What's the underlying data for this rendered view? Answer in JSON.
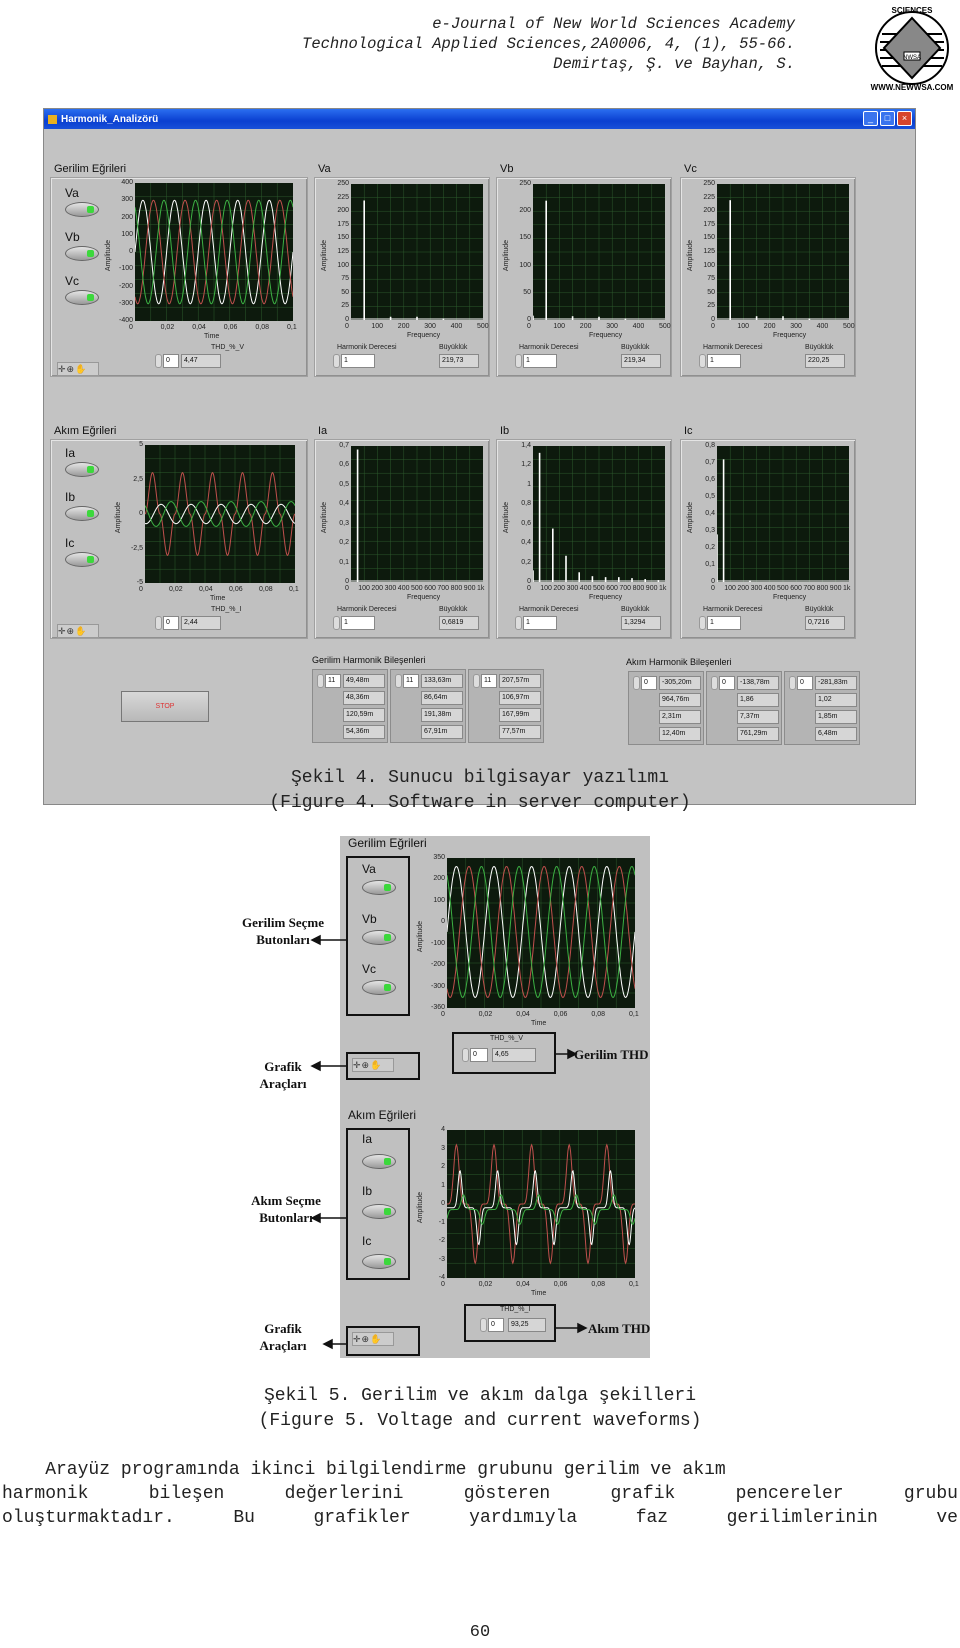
{
  "header": {
    "line1": "e-Journal of New World Sciences Academy",
    "line2": "Technological Applied Sciences,2A0006, 4, (1), 55-66.",
    "line3": "Demirtaş, Ş. ve Bayhan, S.",
    "logo_text_top": "SCIENCES",
    "logo_text_left": "NEW WORLD",
    "logo_text_right": "ACADEMY",
    "logo_url": "WWW.NEWWSA.COM",
    "logo_center": "NWSA"
  },
  "window": {
    "title": "Harmonik_Analizörü",
    "buttons": [
      "_",
      "□",
      "×"
    ]
  },
  "voltage": {
    "group_title": "Gerilim Eğrileri",
    "switches": [
      "Va",
      "Vb",
      "Vc"
    ],
    "yticks": [
      "400",
      "300",
      "200",
      "100",
      "0",
      "-100",
      "-200",
      "-300",
      "-400"
    ],
    "xticks": [
      "0",
      "0,02",
      "0,04",
      "0,06",
      "0,08",
      "0,1"
    ],
    "xlabel": "Time",
    "ylabel": "Amplitude",
    "thd_label": "THD_%_V",
    "thd_index": "0",
    "thd_value": "4,47"
  },
  "current": {
    "group_title": "Akım Eğrileri",
    "switches": [
      "Ia",
      "Ib",
      "Ic"
    ],
    "yticks": [
      "5",
      "2,5",
      "0",
      "-2,5",
      "-5"
    ],
    "xticks": [
      "0",
      "0,02",
      "0,04",
      "0,06",
      "0,08",
      "0,1"
    ],
    "xlabel": "Time",
    "ylabel": "Amplitude",
    "thd_label": "THD_%_I",
    "thd_index": "0",
    "thd_value": "2,44"
  },
  "spectra": [
    {
      "title": "Va",
      "yticks": [
        "250",
        "225",
        "200",
        "175",
        "150",
        "125",
        "100",
        "75",
        "50",
        "25",
        "0"
      ],
      "xticks": [
        "0",
        "100",
        "200",
        "300",
        "400",
        "500"
      ],
      "xlabel": "Frequency",
      "ylabel": "Amplitude",
      "harm_label": "Harmonik Derecesi",
      "harm_value": "1",
      "mag_label": "Büyüklük",
      "mag_value": "219,73"
    },
    {
      "title": "Vb",
      "yticks": [
        "250",
        "200",
        "150",
        "100",
        "50",
        "0"
      ],
      "xticks": [
        "0",
        "100",
        "200",
        "300",
        "400",
        "500"
      ],
      "xlabel": "Frequency",
      "ylabel": "Amplitude",
      "harm_label": "Harmonik Derecesi",
      "harm_value": "1",
      "mag_label": "Büyüklük",
      "mag_value": "219,34"
    },
    {
      "title": "Vc",
      "yticks": [
        "250",
        "225",
        "200",
        "175",
        "150",
        "125",
        "100",
        "75",
        "50",
        "25",
        "0"
      ],
      "xticks": [
        "0",
        "100",
        "200",
        "300",
        "400",
        "500"
      ],
      "xlabel": "Frequency",
      "ylabel": "Amplitude",
      "harm_label": "Harmonik Derecesi",
      "harm_value": "1",
      "mag_label": "Büyüklük",
      "mag_value": "220,25"
    },
    {
      "title": "Ia",
      "yticks": [
        "0,7",
        "0,6",
        "0,5",
        "0,4",
        "0,3",
        "0,2",
        "0,1",
        "0"
      ],
      "xticks": [
        "0",
        "100",
        "200",
        "300",
        "400",
        "500",
        "600",
        "700",
        "800",
        "900",
        "1k"
      ],
      "xlabel": "Frequency",
      "ylabel": "Amplitude",
      "harm_label": "Harmonik Derecesi",
      "harm_value": "1",
      "mag_label": "Büyüklük",
      "mag_value": "0,6819"
    },
    {
      "title": "Ib",
      "yticks": [
        "1,4",
        "1,2",
        "1",
        "0,8",
        "0,6",
        "0,4",
        "0,2",
        "0"
      ],
      "xticks": [
        "0",
        "100",
        "200",
        "300",
        "400",
        "500",
        "600",
        "700",
        "800",
        "900",
        "1k"
      ],
      "xlabel": "Frequency",
      "ylabel": "Amplitude",
      "harm_label": "Harmonik Derecesi",
      "harm_value": "1",
      "mag_label": "Büyüklük",
      "mag_value": "1,3294"
    },
    {
      "title": "Ic",
      "yticks": [
        "0,8",
        "0,7",
        "0,6",
        "0,5",
        "0,4",
        "0,3",
        "0,2",
        "0,1",
        "0"
      ],
      "xticks": [
        "0",
        "100",
        "200",
        "300",
        "400",
        "500",
        "600",
        "700",
        "800",
        "900",
        "1k"
      ],
      "xlabel": "Frequency",
      "ylabel": "Amplitude",
      "harm_label": "Harmonik Derecesi",
      "harm_value": "1",
      "mag_label": "Büyüklük",
      "mag_value": "0,7216"
    }
  ],
  "stop_label": "STOP",
  "voltage_harmonics": {
    "title": "Gerilim Harmonik Bileşenleri",
    "arrays": [
      {
        "index": "11",
        "values": [
          "49,48m",
          "48,36m",
          "120,59m",
          "54,36m"
        ]
      },
      {
        "index": "11",
        "values": [
          "133,63m",
          "86,64m",
          "191,38m",
          "67,91m"
        ]
      },
      {
        "index": "11",
        "values": [
          "207,57m",
          "106,97m",
          "167,99m",
          "77,57m"
        ]
      }
    ]
  },
  "current_harmonics": {
    "title": "Akım Harmonik Bileşenleri",
    "arrays": [
      {
        "index": "0",
        "values": [
          "-305,20m",
          "964,76m",
          "2,31m",
          "12,40m"
        ]
      },
      {
        "index": "0",
        "values": [
          "-138,78m",
          "1,86",
          "7,37m",
          "761,29m"
        ]
      },
      {
        "index": "0",
        "values": [
          "-281,83m",
          "1,02",
          "1,85m",
          "6,48m"
        ]
      }
    ]
  },
  "caption4": {
    "line1": "Şekil 4. Sunucu bilgisayar yazılımı",
    "line2": "(Figure 4. Software in server computer)"
  },
  "fig5": {
    "voltage_title": "Gerilim Eğrileri",
    "voltage_switches": [
      "Va",
      "Vb",
      "Vc"
    ],
    "voltage_yticks": [
      "350",
      "200",
      "100",
      "0",
      "-100",
      "-200",
      "-300",
      "-360"
    ],
    "current_title": "Akım Eğrileri",
    "current_switches": [
      "Ia",
      "Ib",
      "Ic"
    ],
    "current_yticks": [
      "4",
      "3",
      "2",
      "1",
      "0",
      "-1",
      "-2",
      "-3",
      "-4"
    ],
    "xticks": [
      "0",
      "0,02",
      "0,04",
      "0,06",
      "0,08",
      "0,1"
    ],
    "xlabel": "Time",
    "ylabel": "Amplitude",
    "thd_v_label": "THD_%_V",
    "thd_v_index": "0",
    "thd_v_value": "4,65",
    "thd_i_label": "THD_%_I",
    "thd_i_index": "0",
    "thd_i_value": "93,25",
    "annotations": {
      "v_buttons": "Gerilim Seçme Butonları",
      "tools1": "Grafik Araçları",
      "v_thd": "Gerilim THD",
      "i_buttons": "Akım Seçme Butonları",
      "tools2": "Grafik Araçları",
      "i_thd": "Akım THD"
    }
  },
  "caption5": {
    "line1": "Şekil 5. Gerilim ve akım dalga şekilleri",
    "line2": "(Figure 5. Voltage and current waveforms)"
  },
  "paragraph": {
    "line1": "    Arayüz programında ikinci bilgilendirme grubunu gerilim ve akım",
    "line2": [
      "harmonik",
      "bileşen",
      "değerlerini",
      "gösteren",
      "grafik",
      "pencereler",
      "grubu"
    ],
    "line3": [
      "oluşturmaktadır.",
      "Bu",
      "grafikler",
      "yardımıyla",
      "faz",
      "gerilimlerinin",
      "ve"
    ]
  },
  "page_number": "60",
  "chart_data": [
    {
      "type": "line",
      "title": "Gerilim Eğrileri",
      "xlabel": "Time",
      "ylabel": "Amplitude",
      "xlim": [
        0,
        0.1
      ],
      "ylim": [
        -400,
        400
      ],
      "series": [
        {
          "name": "Va",
          "amplitude": 300,
          "frequency_hz": 50,
          "color": "#ffffff"
        },
        {
          "name": "Vb",
          "amplitude": 300,
          "frequency_hz": 50,
          "color": "#c0504d"
        },
        {
          "name": "Vc",
          "amplitude": 300,
          "frequency_hz": 50,
          "color": "#3cb043"
        }
      ]
    },
    {
      "type": "line",
      "title": "Akım Eğrileri",
      "xlabel": "Time",
      "ylabel": "Amplitude",
      "xlim": [
        0,
        0.1
      ],
      "ylim": [
        -5,
        5
      ],
      "series": [
        {
          "name": "Ia",
          "amplitude": 3,
          "frequency_hz": 50,
          "color": "#c0504d"
        },
        {
          "name": "Ib",
          "amplitude": 0.7,
          "frequency_hz": 50,
          "color": "#ffffff"
        },
        {
          "name": "Ic",
          "amplitude": 0.9,
          "frequency_hz": 50,
          "color": "#3cb043"
        }
      ]
    },
    {
      "type": "bar",
      "title": "Va",
      "xlabel": "Frequency",
      "ylabel": "Amplitude",
      "xlim": [
        0,
        500
      ],
      "ylim": [
        0,
        250
      ],
      "x": [
        50,
        150,
        250,
        350
      ],
      "values": [
        219.73,
        6,
        6,
        3
      ]
    },
    {
      "type": "bar",
      "title": "Vb",
      "xlabel": "Frequency",
      "ylabel": "Amplitude",
      "xlim": [
        0,
        500
      ],
      "ylim": [
        0,
        250
      ],
      "x": [
        0,
        50,
        150,
        250,
        350
      ],
      "values": [
        8,
        219.34,
        7,
        6,
        3
      ]
    },
    {
      "type": "bar",
      "title": "Vc",
      "xlabel": "Frequency",
      "ylabel": "Amplitude",
      "xlim": [
        0,
        500
      ],
      "ylim": [
        0,
        250
      ],
      "x": [
        50,
        150,
        250,
        350
      ],
      "values": [
        220.25,
        7,
        7,
        3
      ]
    },
    {
      "type": "bar",
      "title": "Ia",
      "xlabel": "Frequency",
      "ylabel": "Amplitude",
      "xlim": [
        0,
        1000
      ],
      "ylim": [
        0,
        0.7
      ],
      "x": [
        50
      ],
      "values": [
        0.6819
      ]
    },
    {
      "type": "bar",
      "title": "Ib",
      "xlabel": "Frequency",
      "ylabel": "Amplitude",
      "xlim": [
        0,
        1000
      ],
      "ylim": [
        0,
        1.4
      ],
      "x": [
        0,
        50,
        150,
        250,
        350,
        450,
        550,
        650,
        750,
        850,
        950
      ],
      "values": [
        0.12,
        1.3294,
        0.55,
        0.27,
        0.1,
        0.06,
        0.05,
        0.05,
        0.04,
        0.03,
        0.02
      ]
    },
    {
      "type": "bar",
      "title": "Ic",
      "xlabel": "Frequency",
      "ylabel": "Amplitude",
      "xlim": [
        0,
        1000
      ],
      "ylim": [
        0,
        0.8
      ],
      "x": [
        0,
        50,
        250
      ],
      "values": [
        0.28,
        0.7216,
        0.01
      ]
    },
    {
      "type": "line",
      "title": "Gerilim Eğrileri (Şekil 5)",
      "xlabel": "Time",
      "ylabel": "Amplitude",
      "xlim": [
        0,
        0.1
      ],
      "ylim": [
        -360,
        350
      ],
      "series": [
        {
          "name": "Va",
          "amplitude": 310,
          "frequency_hz": 50
        },
        {
          "name": "Vb",
          "amplitude": 310,
          "frequency_hz": 50
        },
        {
          "name": "Vc",
          "amplitude": 310,
          "frequency_hz": 50
        }
      ]
    },
    {
      "type": "line",
      "title": "Akım Eğrileri (Şekil 5)",
      "xlabel": "Time",
      "ylabel": "Amplitude",
      "xlim": [
        0,
        0.1
      ],
      "ylim": [
        -4,
        4
      ],
      "series": [
        {
          "name": "Ia",
          "amplitude": 3.2,
          "frequency_hz": 50
        },
        {
          "name": "Ib",
          "amplitude": 2,
          "frequency_hz": 50
        },
        {
          "name": "Ic",
          "amplitude": 0.8,
          "frequency_hz": 50
        }
      ]
    }
  ]
}
